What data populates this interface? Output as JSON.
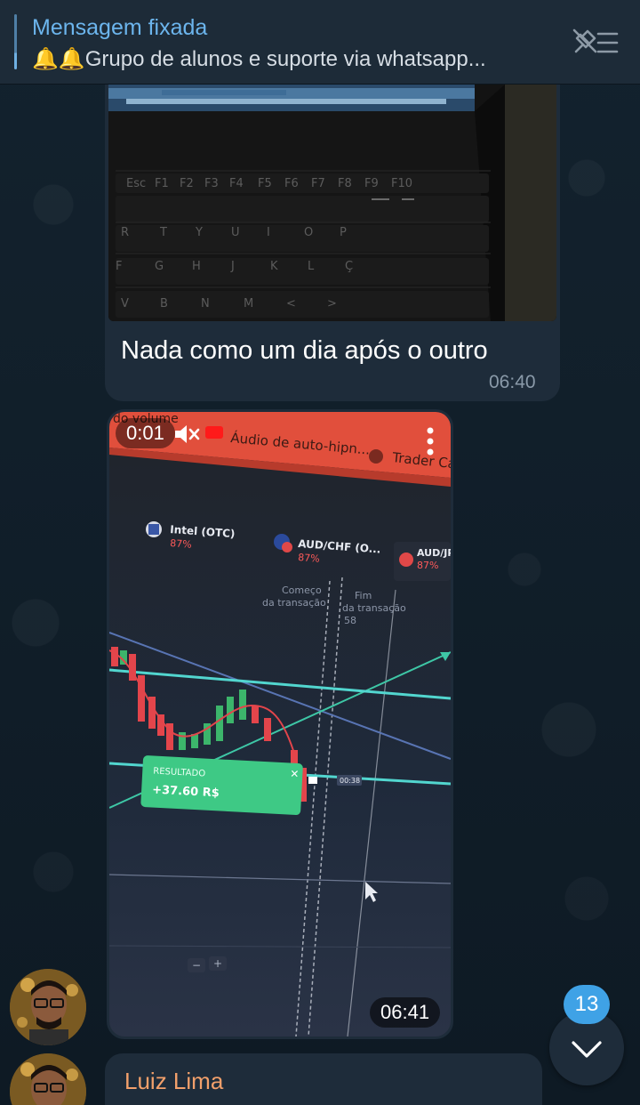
{
  "pinned": {
    "title": "Mensagem fixada",
    "preview": "🔔🔔Grupo de alunos e suporte via whatsapp...",
    "unpin_icon": "unpin-list-icon"
  },
  "message_photo": {
    "caption": "Nada como um dia após o outro",
    "time": "06:40",
    "photo_keys": {
      "row1": [
        "Esc",
        "F1",
        "F2",
        "F3",
        "F4",
        "F5",
        "F6",
        "F7",
        "F8",
        "F9",
        "F10"
      ],
      "row2": [
        "R",
        "T",
        "Y",
        "U",
        "I",
        "O",
        "P"
      ],
      "row3": [
        "F",
        "G",
        "H",
        "J",
        "K",
        "L",
        "Ç"
      ],
      "row4": [
        "V",
        "B",
        "N",
        "M",
        "<",
        ">"
      ]
    }
  },
  "message_video": {
    "elapsed": "0:01",
    "time": "06:41",
    "overlay": {
      "tab_partial": "do volume",
      "tab_title": "Áudio de auto-hipn...",
      "tab_right": "Trader Can",
      "assets": [
        {
          "name": "Intel (OTC)",
          "payout": "87%"
        },
        {
          "name": "AUD/CHF (O...",
          "payout": "87%"
        },
        {
          "name": "AUD/JP",
          "payout": "87%"
        }
      ],
      "start_label_1": "Começo",
      "start_label_2": "da transação",
      "end_label_1": "Fim",
      "end_label_2": "da transação",
      "end_value": "58",
      "result_title": "RESULTADO",
      "result_value": "+37.60 R$",
      "price_tag": "00:38",
      "zoom_minus": "−",
      "zoom_plus": "+"
    }
  },
  "message_next": {
    "sender": "Luiz Lima"
  },
  "scroll_down": {
    "unread_count": "13"
  },
  "colors": {
    "accent": "#6cb5ed",
    "bubble": "#1e2c3a",
    "badge": "#3fa2e6",
    "sender_name": "#f2a06b"
  }
}
